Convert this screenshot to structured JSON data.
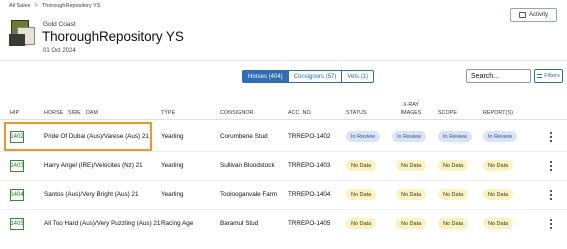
{
  "breadcrumb": {
    "root": "All Sales",
    "sep": ">",
    "current": "ThoroughRepository YS"
  },
  "header": {
    "subtitle": "Gold Coast",
    "title": "ThoroughRepository YS",
    "date": "01 Oct 2024",
    "activity_label": "Activity"
  },
  "tabs": [
    {
      "label": "Horses (404)"
    },
    {
      "label": "Consignors (57)"
    },
    {
      "label": "Vets (1)"
    }
  ],
  "search": {
    "value": "Search..."
  },
  "filters_label": "Filters",
  "columns": {
    "hip": "HIP",
    "horse": "HORSE",
    "sire": "SIRE",
    "dam": "DAM",
    "type": "TYPE",
    "consignor": "CONSIGNOR",
    "acc": "ACC. NO",
    "status": "STATUS",
    "xray_1": "X-RAY",
    "xray_2": "IMAGES",
    "scope": "SCOPE",
    "reports": "REPORT(S)"
  },
  "rows": [
    {
      "hip": "1402",
      "horse": "Pride Of Dubai (Aus)/Varese (Aus) 21",
      "type": "Yearling",
      "consignor": "Corumbene Stud",
      "acc": "TRREPO-1402",
      "status": "In Review",
      "xray": "In Review",
      "scope": "In Review",
      "reports": "In Review"
    },
    {
      "hip": "1403",
      "horse": "Harry Angel (IRE)/Velocites (Nz) 21",
      "type": "Yearling",
      "consignor": "Sullivan Bloodstock",
      "acc": "TRREPO-1403",
      "status": "No Data",
      "xray": "No Data",
      "scope": "No Data",
      "reports": "No Data"
    },
    {
      "hip": "1404",
      "horse": "Santos (Aus)/Very Bright (Aus) 21",
      "type": "Yearling",
      "consignor": "Toolooganvale Farm",
      "acc": "TRREPO-1404",
      "status": "No Data",
      "xray": "No Data",
      "scope": "No Data",
      "reports": "No Data"
    },
    {
      "hip": "1405",
      "horse": "All Too Hard (Aus)/Very Puzzling (Aus) 21",
      "type": "Racing Age",
      "consignor": "Baramul Stud",
      "acc": "TRREPO-1405",
      "status": "No Data",
      "xray": "No Data",
      "scope": "No Data",
      "reports": "No Data"
    }
  ],
  "colors": {
    "accent": "#2f6db5",
    "hip_green": "#3a8a3a",
    "highlight": "#e89b2a",
    "review_bg": "#dbe3f7",
    "nodata_bg": "#fbf3bf"
  }
}
